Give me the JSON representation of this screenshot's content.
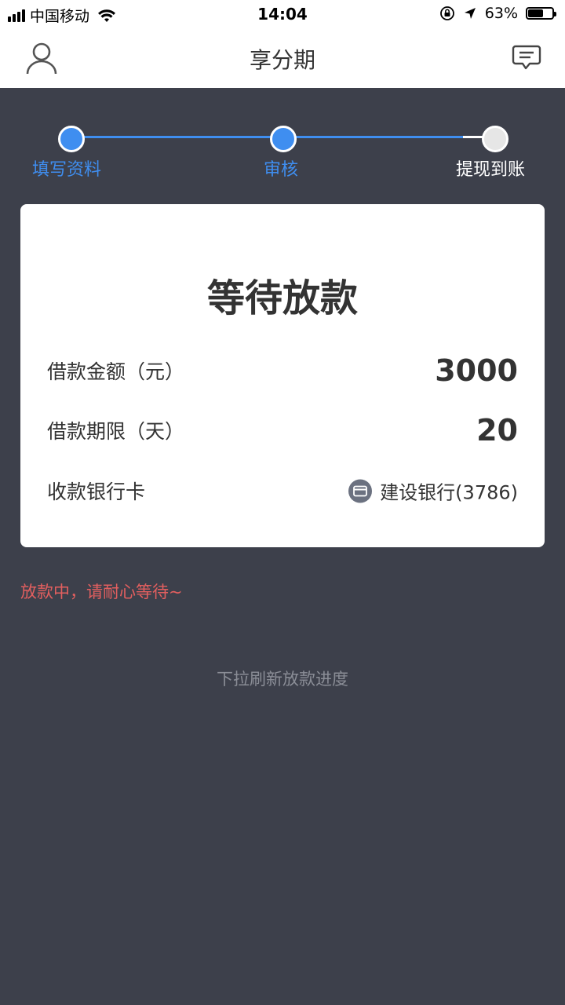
{
  "status_bar": {
    "carrier": "中国移动",
    "time": "14:04",
    "battery": "63%",
    "battery_level": 0.63
  },
  "nav": {
    "title": "享分期",
    "user_icon": "user-icon",
    "message_icon": "message-icon"
  },
  "steps": [
    {
      "label": "填写资料",
      "state": "done"
    },
    {
      "label": "审核",
      "state": "done"
    },
    {
      "label": "提现到账",
      "state": "pending"
    }
  ],
  "colors": {
    "accent": "#3f8ef0",
    "background": "#3d404b",
    "warning": "#e35f5f",
    "pending_dot": "#e6e6e6"
  },
  "card": {
    "title": "等待放款",
    "amount_label": "借款金额（元）",
    "amount_value": "3000",
    "term_label": "借款期限（天）",
    "term_value": "20",
    "bank_label": "收款银行卡",
    "bank_value": "建设银行(3786)",
    "bank_icon": "card-icon"
  },
  "status_message": "放款中，请耐心等待~",
  "refresh_hint": "下拉刷新放款进度"
}
